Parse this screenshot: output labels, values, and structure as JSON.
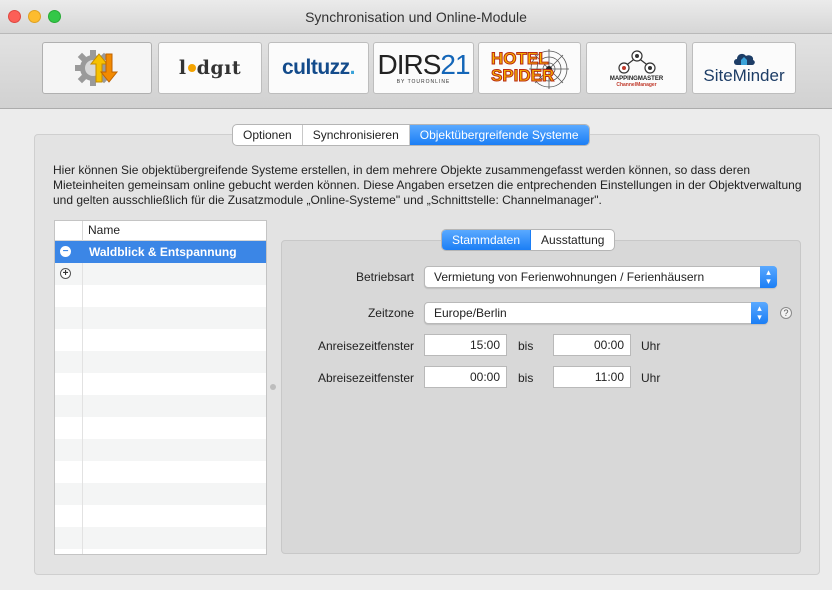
{
  "window": {
    "title": "Synchronisation und Online-Module"
  },
  "toolbar": {
    "modules": [
      {
        "name": "sync-settings",
        "icon": "gear-arrows-icon"
      },
      {
        "name": "lodgit",
        "text": "l",
        "text2": "dgıt"
      },
      {
        "name": "cultuzz",
        "text": "cultuzz",
        "dot": "."
      },
      {
        "name": "dirs21",
        "text": "DIRS",
        "num": "21",
        "sub": "BY TOURONLINE"
      },
      {
        "name": "hotel-spider",
        "line1": "HOTEL",
        "line2": "SPIDER"
      },
      {
        "name": "mapping-master",
        "line1": "MAPPINGMASTER",
        "line2": "ChannelManager"
      },
      {
        "name": "siteminder",
        "text": "SiteMinder"
      }
    ]
  },
  "tabs": {
    "items": [
      "Optionen",
      "Synchronisieren",
      "Objektübergreifende Systeme"
    ],
    "selected": 2
  },
  "description": "Hier können Sie objektübergreifende Systeme erstellen, in dem mehrere Objekte zusammengefasst werden können, so dass deren Mieteinheiten gemeinsam online gebucht werden können. Diese Angaben ersetzen die entprechenden Einstellungen in der Objektverwaltung und gelten ausschließlich für die Zusatzmodule „Online-Systeme\" und „Schnittstelle: Channelmanager\".",
  "list": {
    "column": "Name",
    "items": [
      "Waldblick & Entspannung"
    ],
    "remove_glyph": "−",
    "add_glyph": "+"
  },
  "detail_tabs": {
    "items": [
      "Stammdaten",
      "Ausstattung"
    ],
    "selected": 0
  },
  "form": {
    "betriebsart": {
      "label": "Betriebsart",
      "value": "Vermietung von Ferienwohnungen / Ferienhäusern"
    },
    "zeitzone": {
      "label": "Zeitzone",
      "value": "Europe/Berlin",
      "help": "?"
    },
    "anreise": {
      "label": "Anreisezeitfenster",
      "from": "15:00",
      "sep": "bis",
      "to": "00:00",
      "unit": "Uhr"
    },
    "abreise": {
      "label": "Abreisezeitfenster",
      "from": "00:00",
      "sep": "bis",
      "to": "11:00",
      "unit": "Uhr"
    }
  },
  "colors": {
    "accent": "#1b7ef5",
    "selection": "#3b86e6"
  }
}
